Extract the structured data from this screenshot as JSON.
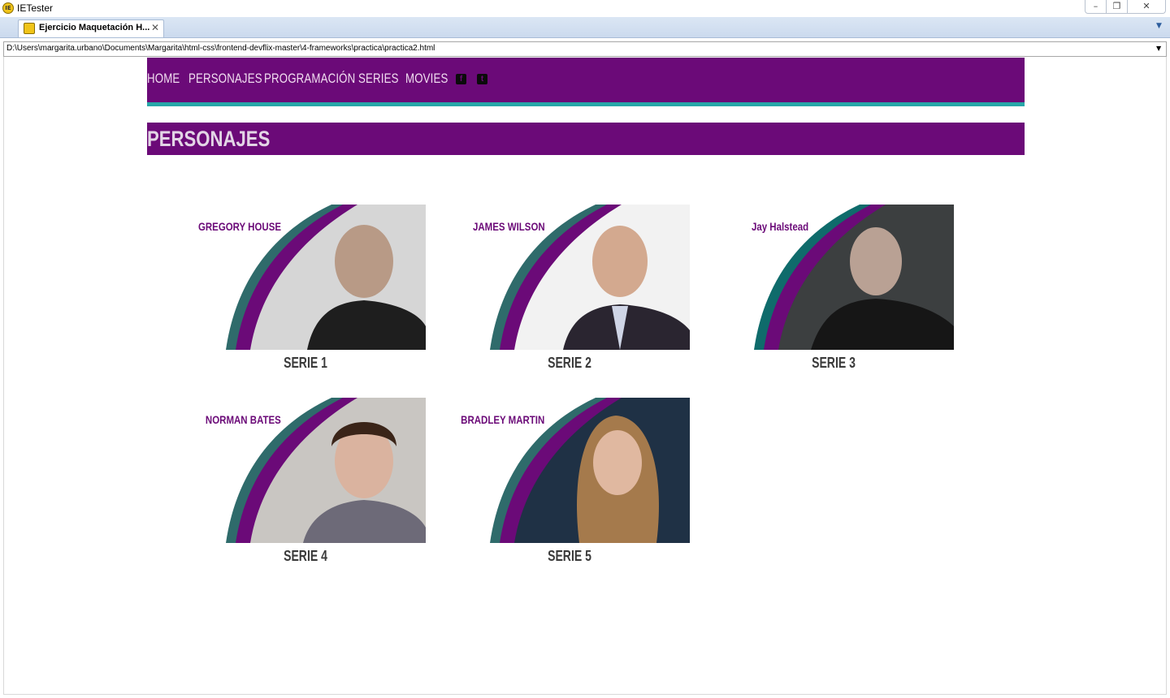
{
  "window": {
    "app_title": "IETester",
    "app_icon": "ie-logo-icon",
    "tab_label": "Ejercicio Maquetación H...",
    "address": "D:\\Users\\margarita.urbano\\Documents\\Margarita\\html-css\\frontend-devflix-master\\4-frameworks\\practica\\practica2.html"
  },
  "colors": {
    "brand_purple": "#6b0a78",
    "accent_teal": "#27a7a8",
    "nav_text": "#f1ddf0"
  },
  "nav": {
    "items": [
      "HOME",
      "PERSONAJES",
      "PROGRAMACIÓN",
      "SERIES",
      "MOVIES"
    ],
    "social_icons": [
      "facebook-icon",
      "twitter-icon"
    ]
  },
  "section": {
    "title": "PERSONAJES"
  },
  "characters": [
    {
      "name": "GREGORY HOUSE",
      "caption": "SERIE 1",
      "photo_bg": "#d6d6d6"
    },
    {
      "name": "JAMES WILSON",
      "caption": "SERIE 2",
      "photo_bg": "#f2f2f2"
    },
    {
      "name": "Jay Halstead",
      "caption": "SERIE 3",
      "photo_bg": "#3c3f40"
    },
    {
      "name": "NORMAN BATES",
      "caption": "SERIE 4",
      "photo_bg": "#c9c6c2"
    },
    {
      "name": "BRADLEY MARTIN",
      "caption": "SERIE 5",
      "photo_bg": "#1f3145"
    }
  ]
}
